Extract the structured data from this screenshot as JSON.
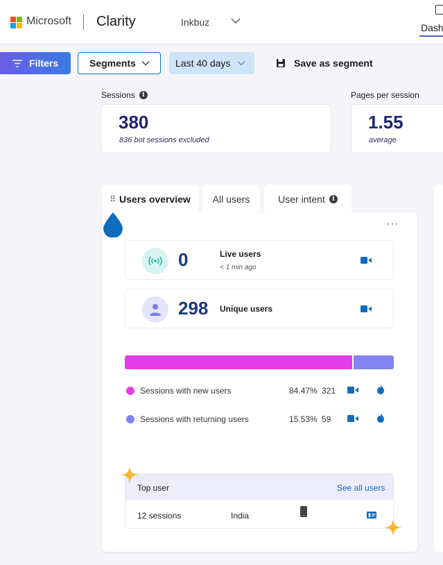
{
  "topbar": {
    "brand": "Microsoft",
    "product": "Clarity",
    "project": "Inkbuz",
    "dashboard_tab": "Dash"
  },
  "filters": {
    "filters_label": "Filters",
    "segments_label": "Segments",
    "date_range": "Last 40 days",
    "save_label": "Save as segment"
  },
  "metrics": {
    "sessions": {
      "label": "Sessions",
      "value": "380",
      "sub": "836 bot sessions excluded"
    },
    "pages_per_session": {
      "label": "Pages per session",
      "value": "1.55",
      "sub": "average"
    }
  },
  "tabs": [
    {
      "label": "Users overview",
      "active": true
    },
    {
      "label": "All users",
      "active": false
    },
    {
      "label": "User intent",
      "active": false
    }
  ],
  "users_overview": {
    "more": "···",
    "live": {
      "value": "0",
      "label": "Live users",
      "sub": "< 1 min ago"
    },
    "unique": {
      "value": "298",
      "label": "Unique users"
    },
    "sessions_split": [
      {
        "label": "Sessions with new users",
        "percent": "84.47%",
        "count": "321",
        "fraction": 0.8447,
        "color": "#e43ce8"
      },
      {
        "label": "Sessions with returning users",
        "percent": "15.53%",
        "count": "59",
        "fraction": 0.1553,
        "color": "#8384f0"
      }
    ],
    "top_user": {
      "title": "Top user",
      "link": "See all users",
      "sessions": "12 sessions",
      "country": "India"
    }
  },
  "colors": {
    "accent": "#0f6cbd",
    "filters_button": "#5d67e8",
    "metric_value": "#1d2470",
    "new_users": "#e43ce8",
    "returning_users": "#8384f0",
    "sparkle": "#f7b733"
  },
  "icons": {
    "filter": "filter-lines-icon",
    "save": "floppy-disk-icon",
    "info": "info-icon",
    "live": "broadcast-icon",
    "person": "person-icon",
    "recording": "video-camera-icon",
    "heatmap": "flame-icon",
    "device": "mobile-phone-icon",
    "contact": "contact-card-icon"
  }
}
